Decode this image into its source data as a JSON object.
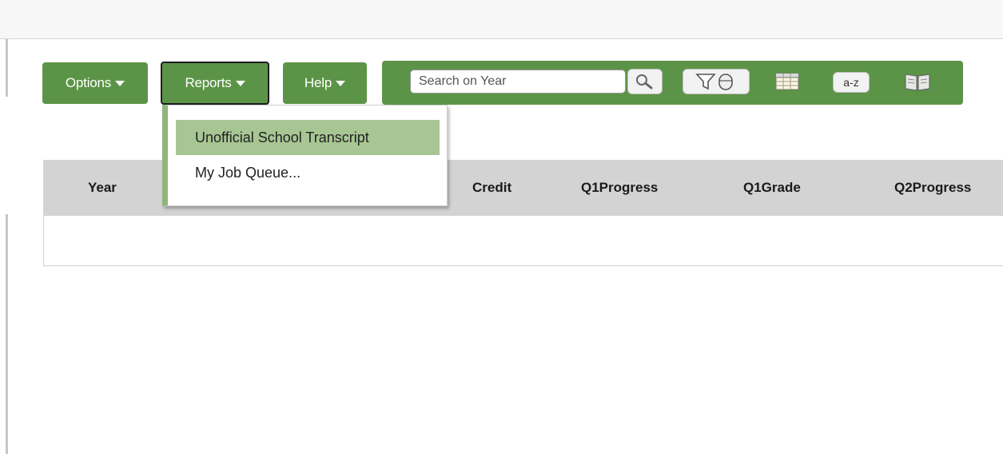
{
  "toolbar_buttons": {
    "options": "Options",
    "reports": "Reports",
    "help": "Help"
  },
  "search": {
    "placeholder": "Search on Year"
  },
  "tool_icons": {
    "az_label": "a-z"
  },
  "reports_menu": {
    "items": [
      "Unofficial School Transcript",
      "My Job Queue..."
    ]
  },
  "table": {
    "columns": [
      "Year",
      "Credit",
      "Q1Progress",
      "Q1Grade",
      "Q2Progress"
    ],
    "rows": []
  },
  "colors": {
    "accent_green": "#5c9447",
    "menu_highlight": "#a7c693",
    "header_gray": "#d3d3d3"
  }
}
